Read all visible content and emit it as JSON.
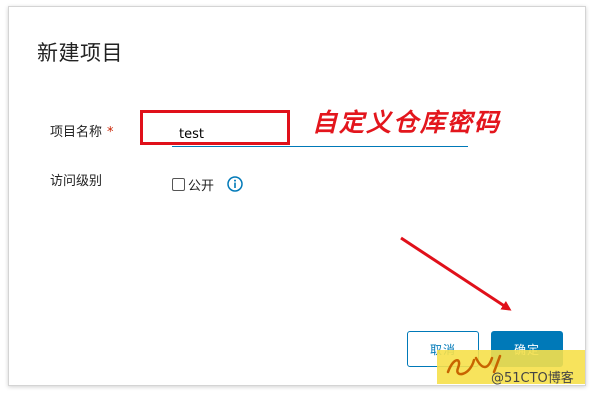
{
  "dialog": {
    "title": "新建项目",
    "project_name_label": "项目名称",
    "required_mark": "*",
    "project_name_value": "test",
    "access_level_label": "访问级别",
    "public_checkbox_label": "公开",
    "public_checked": false,
    "cancel_label": "取消",
    "ok_label": "确定"
  },
  "annotation": {
    "text": "自定义仓库密码"
  },
  "watermark": {
    "site": "@51CTO博客"
  },
  "colors": {
    "accent": "#0079b8",
    "annotation_red": "#e0101a",
    "required_red": "#c92100"
  },
  "icons": [
    "info-icon",
    "arrow-annotation"
  ]
}
